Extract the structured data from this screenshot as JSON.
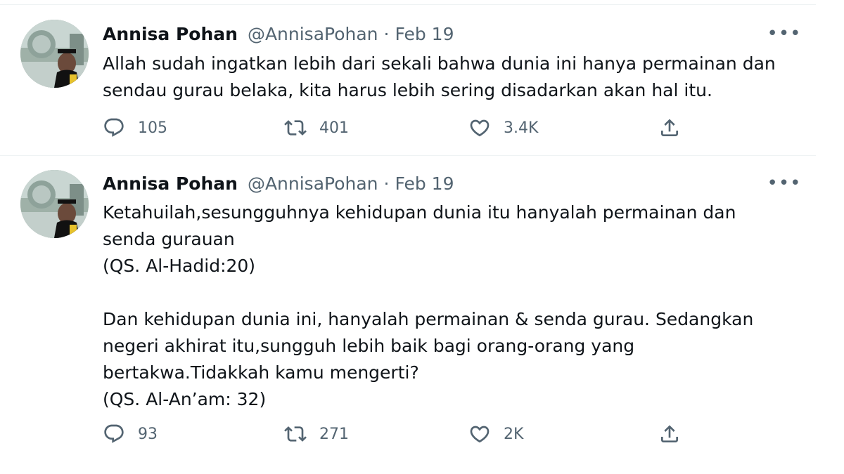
{
  "tweets": [
    {
      "author_name": "Annisa Pohan",
      "handle": "@AnnisaPohan",
      "separator": "·",
      "date": "Feb 19",
      "more_icon": "more-horizontal-icon",
      "text": "Allah sudah ingatkan lebih dari sekali bahwa dunia ini hanya permainan dan\nsendau gurau belaka, kita harus lebih sering disadarkan akan hal itu.",
      "replies": "105",
      "retweets": "401",
      "likes": "3.4K"
    },
    {
      "author_name": "Annisa Pohan",
      "handle": "@AnnisaPohan",
      "separator": "·",
      "date": "Feb 19",
      "more_icon": "more-horizontal-icon",
      "text": "Ketahuilah,sesungguhnya kehidupan dunia itu hanyalah permainan dan\nsenda gurauan\n(QS. Al-Hadid:20)\n\nDan kehidupan dunia ini, hanyalah permainan & senda gurau. Sedangkan\nnegeri akhirat itu,sungguh lebih baik bagi orang-orang yang\nbertakwa.Tidakkah kamu mengerti?\n(QS. Al-An’am: 32)",
      "replies": "93",
      "retweets": "271",
      "likes": "2K"
    }
  ],
  "icons": {
    "reply": "reply-icon",
    "retweet": "retweet-icon",
    "like": "heart-icon",
    "share": "share-icon"
  },
  "colors": {
    "text_primary": "#0f1419",
    "text_secondary": "#536471",
    "divider": "#eff3f4"
  }
}
